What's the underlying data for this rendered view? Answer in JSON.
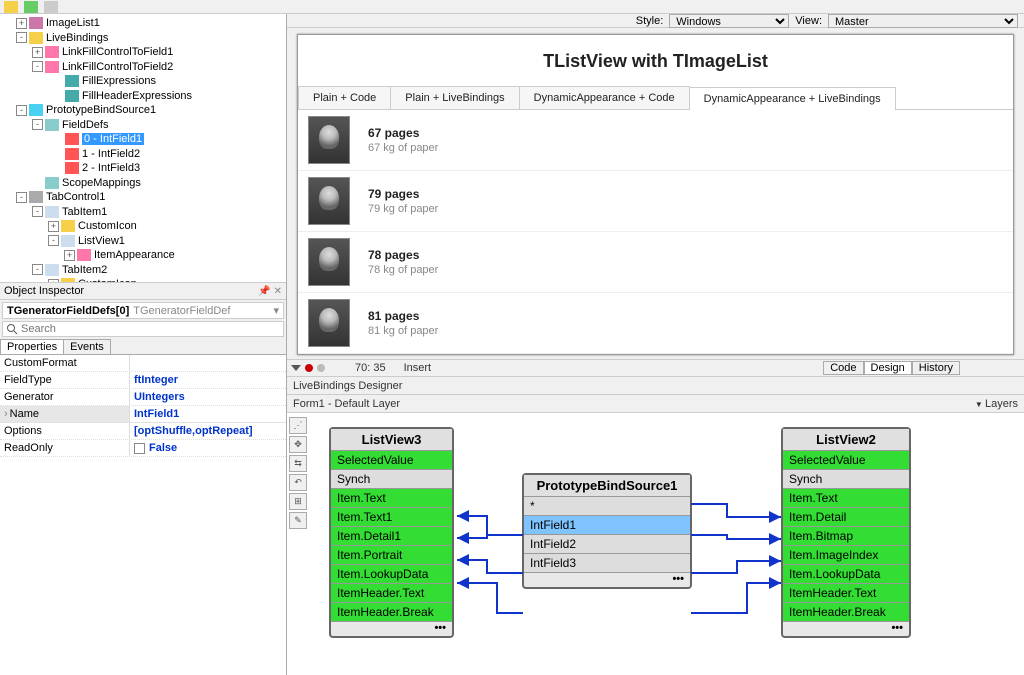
{
  "toolbar_top": {
    "style_label": "Style:",
    "view_label": "View:",
    "style_value": "Windows",
    "view_value": "Master"
  },
  "tree": [
    {
      "ind": 12,
      "tw": "+",
      "ic": "#c7a",
      "lbl": "ImageList1"
    },
    {
      "ind": 12,
      "tw": "-",
      "ic": "#f7d04a",
      "lbl": "LiveBindings"
    },
    {
      "ind": 28,
      "tw": "+",
      "ic": "#f7a",
      "lbl": "LinkFillControlToField1"
    },
    {
      "ind": 28,
      "tw": "-",
      "ic": "#f7a",
      "lbl": "LinkFillControlToField2"
    },
    {
      "ind": 48,
      "tw": "",
      "ic": "#4aa",
      "lbl": "FillExpressions"
    },
    {
      "ind": 48,
      "tw": "",
      "ic": "#4aa",
      "lbl": "FillHeaderExpressions"
    },
    {
      "ind": 12,
      "tw": "-",
      "ic": "#4ad0f0",
      "lbl": "PrototypeBindSource1"
    },
    {
      "ind": 28,
      "tw": "-",
      "ic": "#8cc",
      "lbl": "FieldDefs"
    },
    {
      "ind": 48,
      "tw": "",
      "ic": "#f55",
      "lbl": "0 - IntField1",
      "sel": true
    },
    {
      "ind": 48,
      "tw": "",
      "ic": "#f55",
      "lbl": "1 - IntField2"
    },
    {
      "ind": 48,
      "tw": "",
      "ic": "#f55",
      "lbl": "2 - IntField3"
    },
    {
      "ind": 28,
      "tw": "",
      "ic": "#8cc",
      "lbl": "ScopeMappings"
    },
    {
      "ind": 12,
      "tw": "-",
      "ic": "#aaa",
      "lbl": "TabControl1"
    },
    {
      "ind": 28,
      "tw": "-",
      "ic": "#cde",
      "lbl": "TabItem1"
    },
    {
      "ind": 44,
      "tw": "+",
      "ic": "#f7d04a",
      "lbl": "CustomIcon"
    },
    {
      "ind": 44,
      "tw": "-",
      "ic": "#cde",
      "lbl": "ListView1"
    },
    {
      "ind": 60,
      "tw": "+",
      "ic": "#f7a",
      "lbl": "ItemAppearance"
    },
    {
      "ind": 28,
      "tw": "-",
      "ic": "#cde",
      "lbl": "TabItem2"
    },
    {
      "ind": 44,
      "tw": "+",
      "ic": "#f7d04a",
      "lbl": "CustomIcon"
    }
  ],
  "oi": {
    "title": "Object Inspector",
    "combo_obj": "TGeneratorFieldDefs[0]",
    "combo_cls": "TGeneratorFieldDef",
    "search_ph": "Search",
    "tabs": [
      "Properties",
      "Events"
    ],
    "props": [
      {
        "n": "CustomFormat",
        "v": ""
      },
      {
        "n": "FieldType",
        "v": "ftInteger"
      },
      {
        "n": "Generator",
        "v": "UIntegers"
      },
      {
        "n": "Name",
        "v": "IntField1",
        "sel": true,
        "expand": true
      },
      {
        "n": "Options",
        "v": "[optShuffle,optRepeat]"
      },
      {
        "n": "ReadOnly",
        "v": "False",
        "cb": true
      }
    ]
  },
  "form": {
    "title": "TListView with TImageList",
    "tabs": [
      "Plain + Code",
      "Plain + LiveBindings",
      "DynamicAppearance + Code",
      "DynamicAppearance + LiveBindings"
    ],
    "active_tab": 3,
    "items": [
      {
        "t1": "67 pages",
        "t2": "67 kg of paper"
      },
      {
        "t1": "79 pages",
        "t2": "79 kg of paper"
      },
      {
        "t1": "78 pages",
        "t2": "78 kg of paper"
      },
      {
        "t1": "81 pages",
        "t2": "81 kg of paper"
      }
    ]
  },
  "status": {
    "pos": "70: 35",
    "mode": "Insert",
    "tabs": [
      "Code",
      "Design",
      "History"
    ],
    "active": 1
  },
  "lb": {
    "head": "LiveBindings Designer",
    "sub_left": "Form1   - Default Layer",
    "layers": "Layers",
    "nodes": {
      "lv3": {
        "title": "ListView3",
        "fields": [
          {
            "t": "SelectedValue",
            "c": "green"
          },
          {
            "t": "Synch",
            "c": "gray"
          },
          {
            "t": "Item.Text",
            "c": "green"
          },
          {
            "t": "Item.Text1",
            "c": "green"
          },
          {
            "t": "Item.Detail1",
            "c": "green"
          },
          {
            "t": "Item.Portrait",
            "c": "green"
          },
          {
            "t": "Item.LookupData",
            "c": "green"
          },
          {
            "t": "ItemHeader.Text",
            "c": "green"
          },
          {
            "t": "ItemHeader.Break",
            "c": "green"
          }
        ]
      },
      "pbs": {
        "title": "PrototypeBindSource1",
        "fields": [
          {
            "t": "*",
            "c": "gray"
          },
          {
            "t": "IntField1",
            "c": "blue"
          },
          {
            "t": "IntField2",
            "c": "gray"
          },
          {
            "t": "IntField3",
            "c": "gray"
          }
        ]
      },
      "lv2": {
        "title": "ListView2",
        "fields": [
          {
            "t": "SelectedValue",
            "c": "green"
          },
          {
            "t": "Synch",
            "c": "gray"
          },
          {
            "t": "Item.Text",
            "c": "green"
          },
          {
            "t": "Item.Detail",
            "c": "green"
          },
          {
            "t": "Item.Bitmap",
            "c": "green"
          },
          {
            "t": "Item.ImageIndex",
            "c": "green"
          },
          {
            "t": "Item.LookupData",
            "c": "green"
          },
          {
            "t": "ItemHeader.Text",
            "c": "green"
          },
          {
            "t": "ItemHeader.Break",
            "c": "green"
          }
        ]
      }
    }
  }
}
